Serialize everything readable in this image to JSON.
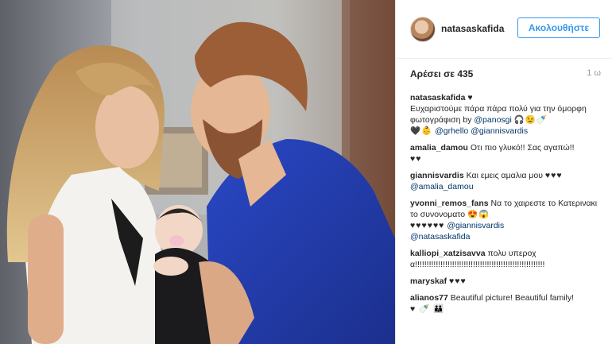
{
  "post": {
    "username": "natasaskafida",
    "follow_label": "Ακολουθήστε",
    "likes": "Αρέσει σε 435",
    "time": "1 ω"
  },
  "comments": [
    {
      "user": "natasaskafida",
      "text": "Ευχαριστούμε πάρα πάρα πολύ για την όμορφη φωτογράφιση by",
      "mention1": "@panosgi",
      "emoji1": "🎧😉🍼",
      "emoji2": "🖤👶",
      "mention2": "@grhello",
      "mention3": "@giannisvardis"
    },
    {
      "user": "amalia_damou",
      "text": "Oτι πιο γλυκό!! Σας αγαπώ!!",
      "emoji": "♥♥"
    },
    {
      "user": "giannisvardis",
      "text": "Και εμεις αμαλια μου",
      "emoji": "♥♥♥",
      "mention": "@amalia_damou"
    },
    {
      "user": "yvonni_remos_fans",
      "text": "Να το χαιρεστε το Κατερινακι το συνονοματο",
      "emoji": "😍😱",
      "hearts": "♥♥♥♥♥♥",
      "mention1": "@giannisvardis",
      "mention2": "@natasaskafida"
    },
    {
      "user": "kalliopi_xatzisavva",
      "text": "πολυ υπεροχα!!!!!!!!!!!!!!!!!!!!!!!!!!!!!!!!!!!!!!!!!!!!!!!!!!!!!!!!"
    },
    {
      "user": "maryskaf",
      "emoji": "♥♥♥"
    },
    {
      "user": "alianos77",
      "text": "Beautiful picture! Beautiful family!",
      "emoji": "♥ 🍼 👪"
    }
  ]
}
